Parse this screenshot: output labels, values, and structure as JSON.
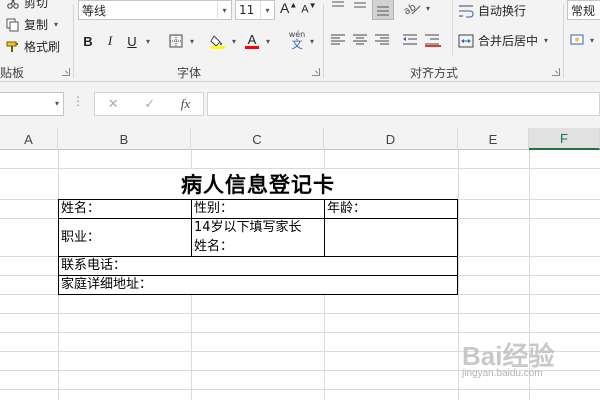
{
  "ribbon": {
    "clipboard": {
      "cut_label": "剪切",
      "copy_label": "复制",
      "format_painter_label": "格式刷",
      "group_label": "贴板"
    },
    "font": {
      "font_name": "等线",
      "font_size": "11",
      "bold": "B",
      "italic": "I",
      "underline": "U",
      "grow_font": "A",
      "shrink_font": "A",
      "phonetic_top": "wén",
      "phonetic_bottom": "文",
      "font_color_letter": "A",
      "group_label": "字体",
      "highlight_color": "#ffff00",
      "font_color": "#ff0000"
    },
    "alignment": {
      "wrap_text_label": "自动换行",
      "merge_center_label": "合并后居中",
      "group_label": "对齐方式"
    },
    "number": {
      "format_value": "常规"
    }
  },
  "formula_bar": {
    "cancel_symbol": "✕",
    "enter_symbol": "✓",
    "fx_label": "fx",
    "formula_value": ""
  },
  "columns": [
    "A",
    "B",
    "C",
    "D",
    "E",
    "F"
  ],
  "form": {
    "title": "病人信息登记卡",
    "name_label": "姓名：",
    "gender_label": "性别：",
    "age_label": "年龄：",
    "occupation_label": "职业：",
    "guardian_line1": "14岁以下填写家长",
    "guardian_line2": "姓名：",
    "phone_label": "联系电话：",
    "address_label": "家庭详细地址："
  },
  "watermark": {
    "brand": "Bai经验",
    "url": "jingyan.baidu.com"
  },
  "colors": {
    "accent": "#217346",
    "ribbon_bg": "#f3f3f3",
    "gridline": "#dadada"
  }
}
